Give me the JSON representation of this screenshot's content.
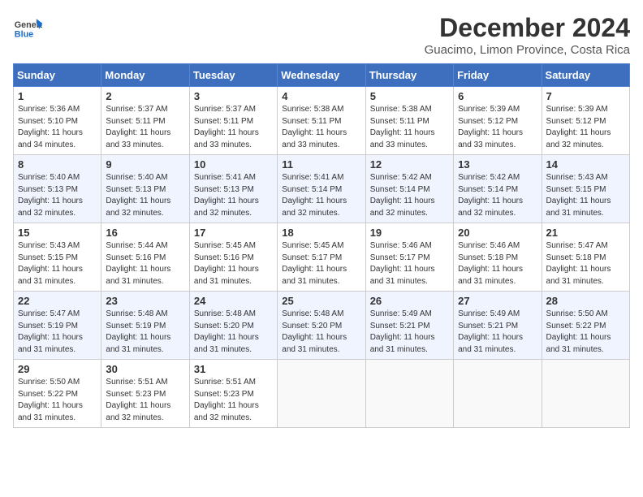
{
  "header": {
    "logo_general": "General",
    "logo_blue": "Blue",
    "title": "December 2024",
    "subtitle": "Guacimo, Limon Province, Costa Rica"
  },
  "calendar": {
    "days_of_week": [
      "Sunday",
      "Monday",
      "Tuesday",
      "Wednesday",
      "Thursday",
      "Friday",
      "Saturday"
    ],
    "weeks": [
      [
        null,
        {
          "day": "2",
          "sunrise": "Sunrise: 5:37 AM",
          "sunset": "Sunset: 5:11 PM",
          "daylight": "Daylight: 11 hours and 33 minutes."
        },
        {
          "day": "3",
          "sunrise": "Sunrise: 5:37 AM",
          "sunset": "Sunset: 5:11 PM",
          "daylight": "Daylight: 11 hours and 33 minutes."
        },
        {
          "day": "4",
          "sunrise": "Sunrise: 5:38 AM",
          "sunset": "Sunset: 5:11 PM",
          "daylight": "Daylight: 11 hours and 33 minutes."
        },
        {
          "day": "5",
          "sunrise": "Sunrise: 5:38 AM",
          "sunset": "Sunset: 5:11 PM",
          "daylight": "Daylight: 11 hours and 33 minutes."
        },
        {
          "day": "6",
          "sunrise": "Sunrise: 5:39 AM",
          "sunset": "Sunset: 5:12 PM",
          "daylight": "Daylight: 11 hours and 33 minutes."
        },
        {
          "day": "7",
          "sunrise": "Sunrise: 5:39 AM",
          "sunset": "Sunset: 5:12 PM",
          "daylight": "Daylight: 11 hours and 32 minutes."
        }
      ],
      [
        {
          "day": "1",
          "sunrise": "Sunrise: 5:36 AM",
          "sunset": "Sunset: 5:10 PM",
          "daylight": "Daylight: 11 hours and 34 minutes."
        },
        {
          "day": "8",
          "sunrise": "Sunrise: 5:40 AM",
          "sunset": "Sunset: 5:13 PM",
          "daylight": "Daylight: 11 hours and 32 minutes."
        },
        {
          "day": "9",
          "sunrise": "Sunrise: 5:40 AM",
          "sunset": "Sunset: 5:13 PM",
          "daylight": "Daylight: 11 hours and 32 minutes."
        },
        {
          "day": "10",
          "sunrise": "Sunrise: 5:41 AM",
          "sunset": "Sunset: 5:13 PM",
          "daylight": "Daylight: 11 hours and 32 minutes."
        },
        {
          "day": "11",
          "sunrise": "Sunrise: 5:41 AM",
          "sunset": "Sunset: 5:14 PM",
          "daylight": "Daylight: 11 hours and 32 minutes."
        },
        {
          "day": "12",
          "sunrise": "Sunrise: 5:42 AM",
          "sunset": "Sunset: 5:14 PM",
          "daylight": "Daylight: 11 hours and 32 minutes."
        },
        {
          "day": "13",
          "sunrise": "Sunrise: 5:42 AM",
          "sunset": "Sunset: 5:14 PM",
          "daylight": "Daylight: 11 hours and 32 minutes."
        }
      ],
      [
        {
          "day": "14",
          "sunrise": "Sunrise: 5:43 AM",
          "sunset": "Sunset: 5:15 PM",
          "daylight": "Daylight: 11 hours and 31 minutes."
        },
        {
          "day": "15",
          "sunrise": "Sunrise: 5:43 AM",
          "sunset": "Sunset: 5:15 PM",
          "daylight": "Daylight: 11 hours and 31 minutes."
        },
        {
          "day": "16",
          "sunrise": "Sunrise: 5:44 AM",
          "sunset": "Sunset: 5:16 PM",
          "daylight": "Daylight: 11 hours and 31 minutes."
        },
        {
          "day": "17",
          "sunrise": "Sunrise: 5:45 AM",
          "sunset": "Sunset: 5:16 PM",
          "daylight": "Daylight: 11 hours and 31 minutes."
        },
        {
          "day": "18",
          "sunrise": "Sunrise: 5:45 AM",
          "sunset": "Sunset: 5:17 PM",
          "daylight": "Daylight: 11 hours and 31 minutes."
        },
        {
          "day": "19",
          "sunrise": "Sunrise: 5:46 AM",
          "sunset": "Sunset: 5:17 PM",
          "daylight": "Daylight: 11 hours and 31 minutes."
        },
        {
          "day": "20",
          "sunrise": "Sunrise: 5:46 AM",
          "sunset": "Sunset: 5:18 PM",
          "daylight": "Daylight: 11 hours and 31 minutes."
        }
      ],
      [
        {
          "day": "21",
          "sunrise": "Sunrise: 5:47 AM",
          "sunset": "Sunset: 5:18 PM",
          "daylight": "Daylight: 11 hours and 31 minutes."
        },
        {
          "day": "22",
          "sunrise": "Sunrise: 5:47 AM",
          "sunset": "Sunset: 5:19 PM",
          "daylight": "Daylight: 11 hours and 31 minutes."
        },
        {
          "day": "23",
          "sunrise": "Sunrise: 5:48 AM",
          "sunset": "Sunset: 5:19 PM",
          "daylight": "Daylight: 11 hours and 31 minutes."
        },
        {
          "day": "24",
          "sunrise": "Sunrise: 5:48 AM",
          "sunset": "Sunset: 5:20 PM",
          "daylight": "Daylight: 11 hours and 31 minutes."
        },
        {
          "day": "25",
          "sunrise": "Sunrise: 5:48 AM",
          "sunset": "Sunset: 5:20 PM",
          "daylight": "Daylight: 11 hours and 31 minutes."
        },
        {
          "day": "26",
          "sunrise": "Sunrise: 5:49 AM",
          "sunset": "Sunset: 5:21 PM",
          "daylight": "Daylight: 11 hours and 31 minutes."
        },
        {
          "day": "27",
          "sunrise": "Sunrise: 5:49 AM",
          "sunset": "Sunset: 5:21 PM",
          "daylight": "Daylight: 11 hours and 31 minutes."
        }
      ],
      [
        {
          "day": "28",
          "sunrise": "Sunrise: 5:50 AM",
          "sunset": "Sunset: 5:22 PM",
          "daylight": "Daylight: 11 hours and 31 minutes."
        },
        {
          "day": "29",
          "sunrise": "Sunrise: 5:50 AM",
          "sunset": "Sunset: 5:22 PM",
          "daylight": "Daylight: 11 hours and 31 minutes."
        },
        {
          "day": "30",
          "sunrise": "Sunrise: 5:51 AM",
          "sunset": "Sunset: 5:23 PM",
          "daylight": "Daylight: 11 hours and 32 minutes."
        },
        {
          "day": "31",
          "sunrise": "Sunrise: 5:51 AM",
          "sunset": "Sunset: 5:23 PM",
          "daylight": "Daylight: 11 hours and 32 minutes."
        },
        null,
        null,
        null
      ]
    ]
  }
}
